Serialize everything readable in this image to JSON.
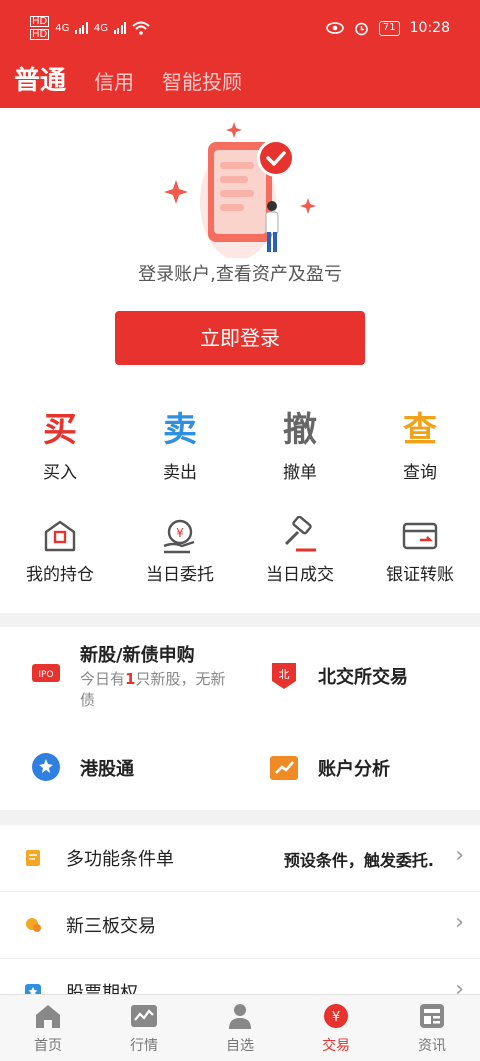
{
  "status_bar": {
    "sim1": "HD",
    "sim2": "HD",
    "net1": "4G",
    "net2": "4G",
    "battery": "71",
    "time": "10:28",
    "eye_icon": "eye-icon",
    "alarm_icon": "alarm-icon",
    "wifi_icon": "wifi-icon"
  },
  "top_tabs": [
    {
      "label": "普通",
      "active": true
    },
    {
      "label": "信用",
      "active": false
    },
    {
      "label": "智能投顾",
      "active": false
    }
  ],
  "login": {
    "hint": "登录账户,查看资产及盈亏",
    "button_label": "立即登录"
  },
  "quick_actions": [
    {
      "glyph": "买",
      "label": "买入",
      "color": "#e8322d"
    },
    {
      "glyph": "卖",
      "label": "卖出",
      "color": "#2f8fe0"
    },
    {
      "glyph": "撤",
      "label": "撤单",
      "color": "#666666"
    },
    {
      "glyph": "查",
      "label": "查询",
      "color": "#f0a21a"
    }
  ],
  "secondary_actions": [
    {
      "icon": "position-icon",
      "label": "我的持仓"
    },
    {
      "icon": "order-icon",
      "label": "当日委托"
    },
    {
      "icon": "gavel-icon",
      "label": "当日成交"
    },
    {
      "icon": "transfer-icon",
      "label": "银证转账"
    }
  ],
  "features": {
    "ipo": {
      "title": "新股/新债申购",
      "sub_prefix": "今日有",
      "sub_count": "1",
      "sub_suffix": "只新股，无新债",
      "icon": "ipo-icon"
    },
    "bse": {
      "title": "北交所交易",
      "icon": "bse-icon"
    },
    "hk": {
      "title": "港股通",
      "icon": "hk-connect-icon"
    },
    "analysis": {
      "title": "账户分析",
      "icon": "analysis-icon"
    }
  },
  "list": [
    {
      "label": "多功能条件单",
      "desc": "预设条件，触发委托.",
      "icon": "condition-order-icon"
    },
    {
      "label": "新三板交易",
      "desc": "",
      "icon": "neeq-icon"
    },
    {
      "label": "股票期权",
      "desc": "",
      "icon": "option-icon"
    }
  ],
  "bottom_nav": [
    {
      "label": "首页",
      "icon": "home-icon",
      "active": false
    },
    {
      "label": "行情",
      "icon": "market-icon",
      "active": false
    },
    {
      "label": "自选",
      "icon": "user-icon",
      "active": false
    },
    {
      "label": "交易",
      "icon": "trade-icon",
      "active": true
    },
    {
      "label": "资讯",
      "icon": "news-icon",
      "active": false
    }
  ],
  "colors": {
    "brand": "#e8322d",
    "accent_blue": "#2f8fe0",
    "accent_orange": "#f0a21a"
  }
}
